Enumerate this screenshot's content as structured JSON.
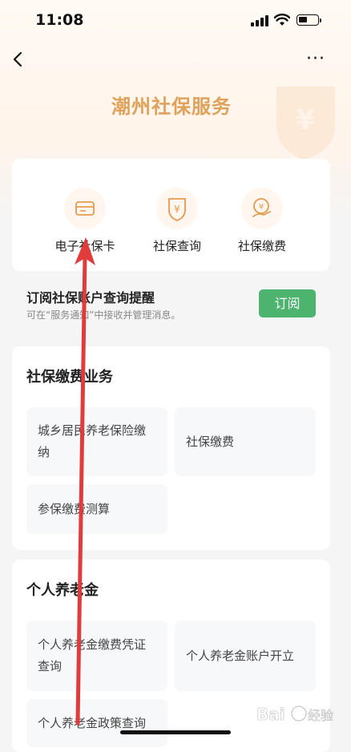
{
  "status_bar": {
    "time": "11:08"
  },
  "nav": {
    "title": "潮州社保服务",
    "more": "···"
  },
  "services": [
    {
      "label": "电子社保卡",
      "icon": "card-icon"
    },
    {
      "label": "社保查询",
      "icon": "shield-yen-icon"
    },
    {
      "label": "社保缴费",
      "icon": "coin-hand-icon"
    }
  ],
  "subscribe": {
    "title": "订阅社保账户查询提醒",
    "desc": "可在“服务通知”中接收并管理消息。",
    "button": "订阅"
  },
  "section_pay": {
    "title": "社保缴费业务",
    "items": [
      "城乡居民养老保险缴纳",
      "社保缴费",
      "参保缴费测算"
    ]
  },
  "section_pension": {
    "title": "个人养老金",
    "items": [
      "个人养老金缴费凭证查询",
      "个人养老金账户开立",
      "个人养老金政策查询"
    ]
  },
  "watermark": {
    "text": "Bai 经验"
  },
  "colors": {
    "title": "#e0a25a",
    "accent_green": "#4cb46e",
    "arrow": "#e23b3b"
  }
}
